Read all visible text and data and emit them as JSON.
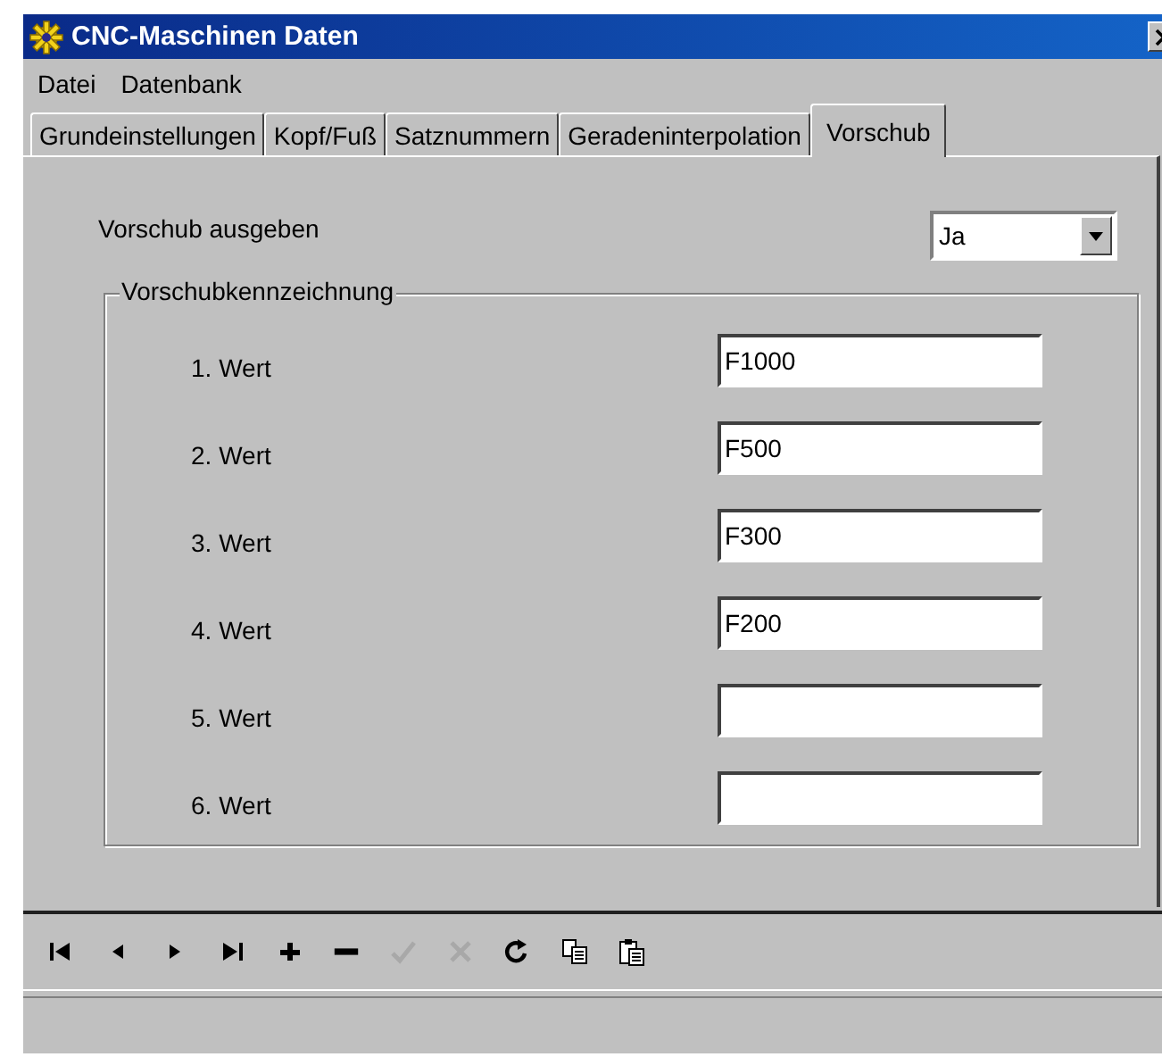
{
  "window": {
    "title": "CNC-Maschinen Daten"
  },
  "menu": [
    "Datei",
    "Datenbank"
  ],
  "tabs": [
    {
      "label": "Grundeinstellungen",
      "selected": false
    },
    {
      "label": "Kopf/Fuß",
      "selected": false
    },
    {
      "label": "Satznummern",
      "selected": false
    },
    {
      "label": "Geradeninterpolation",
      "selected": false
    },
    {
      "label": "Vorschub",
      "selected": true
    }
  ],
  "feed_output": {
    "label": "Vorschub ausgeben",
    "value": "Ja"
  },
  "group": {
    "title": "Vorschubkennzeichnung",
    "fields": [
      {
        "label": "1. Wert",
        "value": "F1000"
      },
      {
        "label": "2. Wert",
        "value": "F500"
      },
      {
        "label": "3. Wert",
        "value": "F300"
      },
      {
        "label": "4. Wert",
        "value": "F200"
      },
      {
        "label": "5. Wert"
      },
      {
        "label": "6. Wert"
      }
    ]
  },
  "navigator": [
    {
      "kind": "first",
      "disabled": false
    },
    {
      "kind": "prior",
      "disabled": false
    },
    {
      "kind": "next",
      "disabled": false
    },
    {
      "kind": "last",
      "disabled": false
    },
    {
      "kind": "insert",
      "disabled": false
    },
    {
      "kind": "delete",
      "disabled": false
    },
    {
      "kind": "post",
      "disabled": true
    },
    {
      "kind": "cancel",
      "disabled": true
    },
    {
      "kind": "refresh",
      "disabled": false
    },
    {
      "kind": "copy",
      "disabled": false
    },
    {
      "kind": "paste",
      "disabled": false
    }
  ]
}
